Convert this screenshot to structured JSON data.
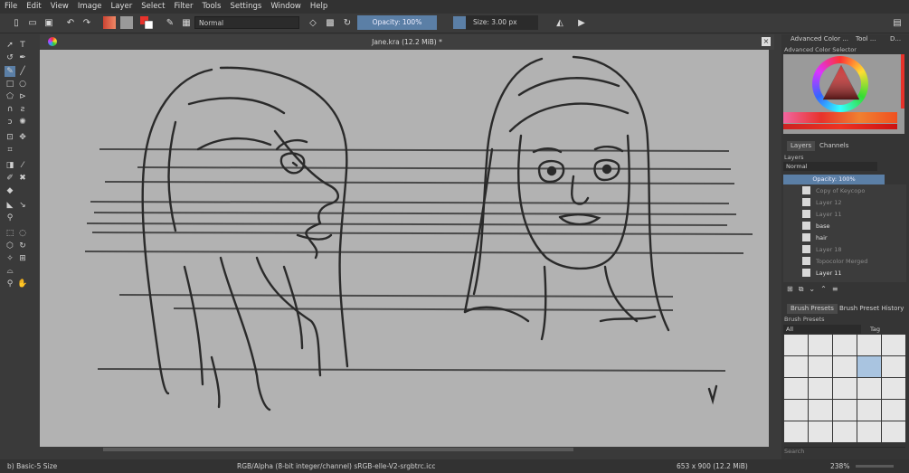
{
  "menu": [
    "File",
    "Edit",
    "View",
    "Image",
    "Layer",
    "Select",
    "Filter",
    "Tools",
    "Settings",
    "Window",
    "Help"
  ],
  "toolbar": {
    "blend_mode": "Normal",
    "opacity": "Opacity: 100%",
    "size": "Size: 3.00 px"
  },
  "document": {
    "title": "Jane.kra (12.2 MiB) *"
  },
  "dock": {
    "tabs_top": [
      "Advanced Color ...",
      "Tool ...",
      "D..."
    ],
    "color_selector_title": "Advanced Color Selector",
    "layer_tabs": [
      "Layers",
      "Channels"
    ],
    "layers_title": "Layers",
    "blend": "Normal",
    "opacity": "Opacity: 100%",
    "layers": [
      {
        "name": "Copy of Keycopo"
      },
      {
        "name": "Layer 12"
      },
      {
        "name": "Layer 11"
      },
      {
        "name": "base"
      },
      {
        "name": "hair"
      },
      {
        "name": "Layer 18"
      },
      {
        "name": "Topocolor Merged"
      },
      {
        "name": "Layer 11"
      }
    ],
    "brush_tabs": [
      "Brush Presets",
      "Brush Preset History"
    ],
    "brush_title": "Brush Presets",
    "brush_filter": "All",
    "tag": "Tag",
    "search": "Search"
  },
  "status": {
    "brush": "b) Basic-5 Size",
    "color": "RGB/Alpha (8-bit integer/channel)  sRGB-elle-V2-srgbtrc.icc",
    "dims": "653 x 900 (12.2 MiB)",
    "zoom": "238%"
  },
  "colors": {
    "accent": "#5b7fa6",
    "fg": "#e8322b",
    "bg": "#ffffff"
  }
}
